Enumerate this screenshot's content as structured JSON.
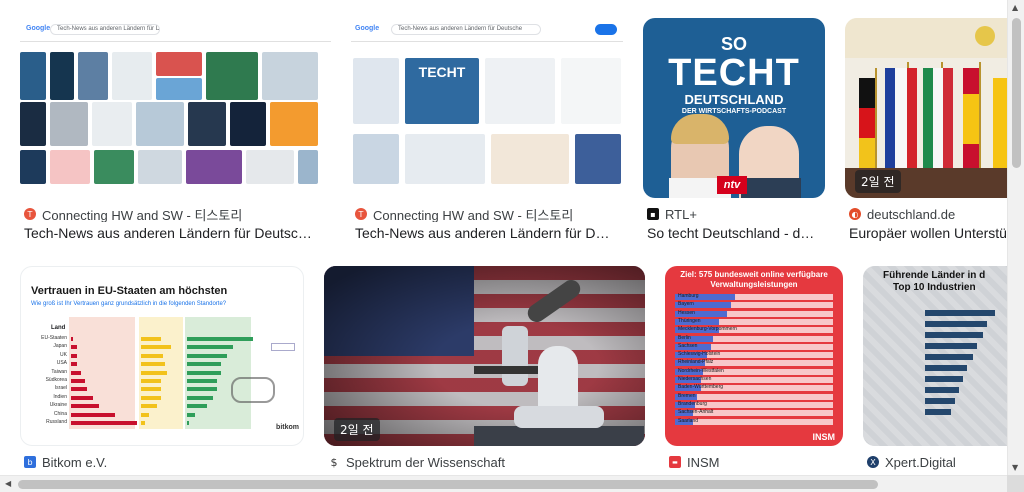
{
  "results": [
    {
      "source": "Connecting HW and SW - 티스토리",
      "title": "Tech-News aus anderen Ländern für Deutsc…",
      "favicon_color": "#e8553d",
      "age": ""
    },
    {
      "source": "Connecting HW and SW - 티스토리",
      "title": "Tech-News aus anderen Ländern für D…",
      "favicon_color": "#e8553d",
      "age": ""
    },
    {
      "source": "RTL+",
      "title": "So techt Deutschland - d…",
      "favicon_color": "#111111",
      "age": ""
    },
    {
      "source": "deutschland.de",
      "title": "Europäer wollen Unterstü",
      "favicon_color": "#e34d2b",
      "age": "2일 전"
    },
    {
      "source": "Bitkom e.V.",
      "title": "",
      "favicon_color": "#2f6fdc",
      "age": ""
    },
    {
      "source": "Spektrum der Wissenschaft",
      "title": "",
      "favicon_color": "#ffffff",
      "age": "2일 전"
    },
    {
      "source": "INSM",
      "title": "",
      "favicon_color": "#e5393f",
      "age": ""
    },
    {
      "source": "Xpert.Digital",
      "title": "",
      "favicon_color": "#1f3f6b",
      "age": ""
    }
  ],
  "thumb_texts": {
    "mini_search_query_1": "Tech-News aus anderen Ländern für Deutschla",
    "mini_search_query_2": "Tech-News aus anderen Ländern für Deutsche",
    "mini_logo": "Google",
    "techt_so": "SO",
    "techt_main": "TECHT",
    "techt_sub": "DEUTSCHLAND",
    "techt_podcast": "DER WIRTSCHAFTS-PODCAST",
    "ntv": "ntv",
    "bitkom_title": "Vertrauen in EU-Staaten am höchsten",
    "bitkom_sub": "Wie groß ist Ihr Vertrauen ganz grundsätzlich in die folgenden Standorte?",
    "bitkom_land": "Land",
    "bitkom_countries": [
      "EU-Staaten",
      "Japan",
      "UK",
      "USA",
      "Taiwan",
      "Südkorea",
      "Israel",
      "Indien",
      "Ukraine",
      "China",
      "Russland"
    ],
    "bitkom_logo": "bitkom",
    "insm_title": "Ziel: 575 bundesweit online verfügbare Verwaltungsleistungen",
    "insm_states": [
      "Hamburg",
      "Bayern",
      "Hessen",
      "Thüringen",
      "Mecklenburg-Vorpommern",
      "Berlin",
      "Sachsen",
      "Schleswig-Holstein",
      "Rheinland-Pfalz",
      "Nordrhein-Westfalen",
      "Niedersachsen",
      "Baden-Württemberg",
      "Bremen",
      "Brandenburg",
      "Sachsen-Anhalt",
      "Saarland"
    ],
    "insm_logo": "INSM",
    "xpert_title": "Führende Länder in d",
    "xpert_sub": "Top 10 Industrien"
  },
  "scroll": {
    "up": "▲",
    "down": "▼",
    "left": "◀",
    "right": "▶"
  }
}
